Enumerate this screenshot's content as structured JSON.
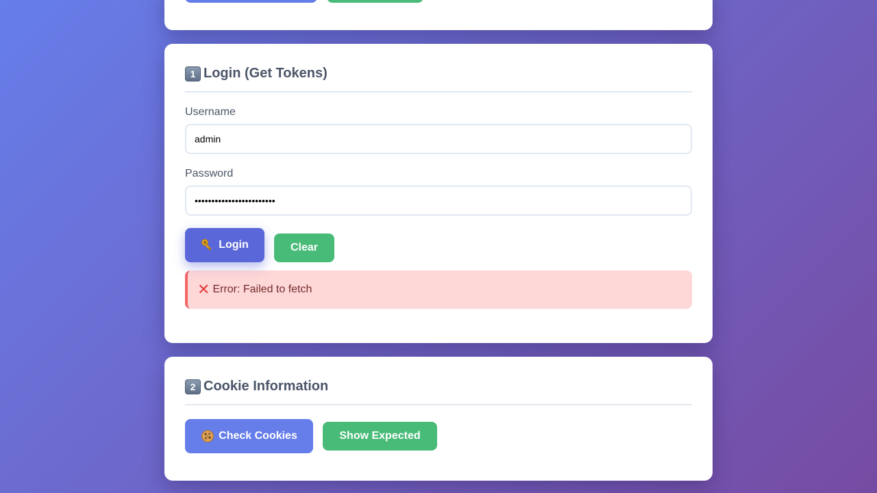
{
  "login_section": {
    "number": "1",
    "title": "Login (Get Tokens)",
    "username_label": "Username",
    "username_value": "admin",
    "password_label": "Password",
    "password_value": "••••••••••••••••••••••••",
    "login_button": "Login",
    "clear_button": "Clear",
    "error_text": "Error: Failed to fetch"
  },
  "cookie_section": {
    "number": "2",
    "title": "Cookie Information",
    "check_button": "Check Cookies",
    "expected_button": "Show Expected"
  },
  "colors": {
    "primary": "#667eea",
    "success": "#48bb78",
    "error_bg": "#fed7d7",
    "error_border": "#f56565"
  }
}
